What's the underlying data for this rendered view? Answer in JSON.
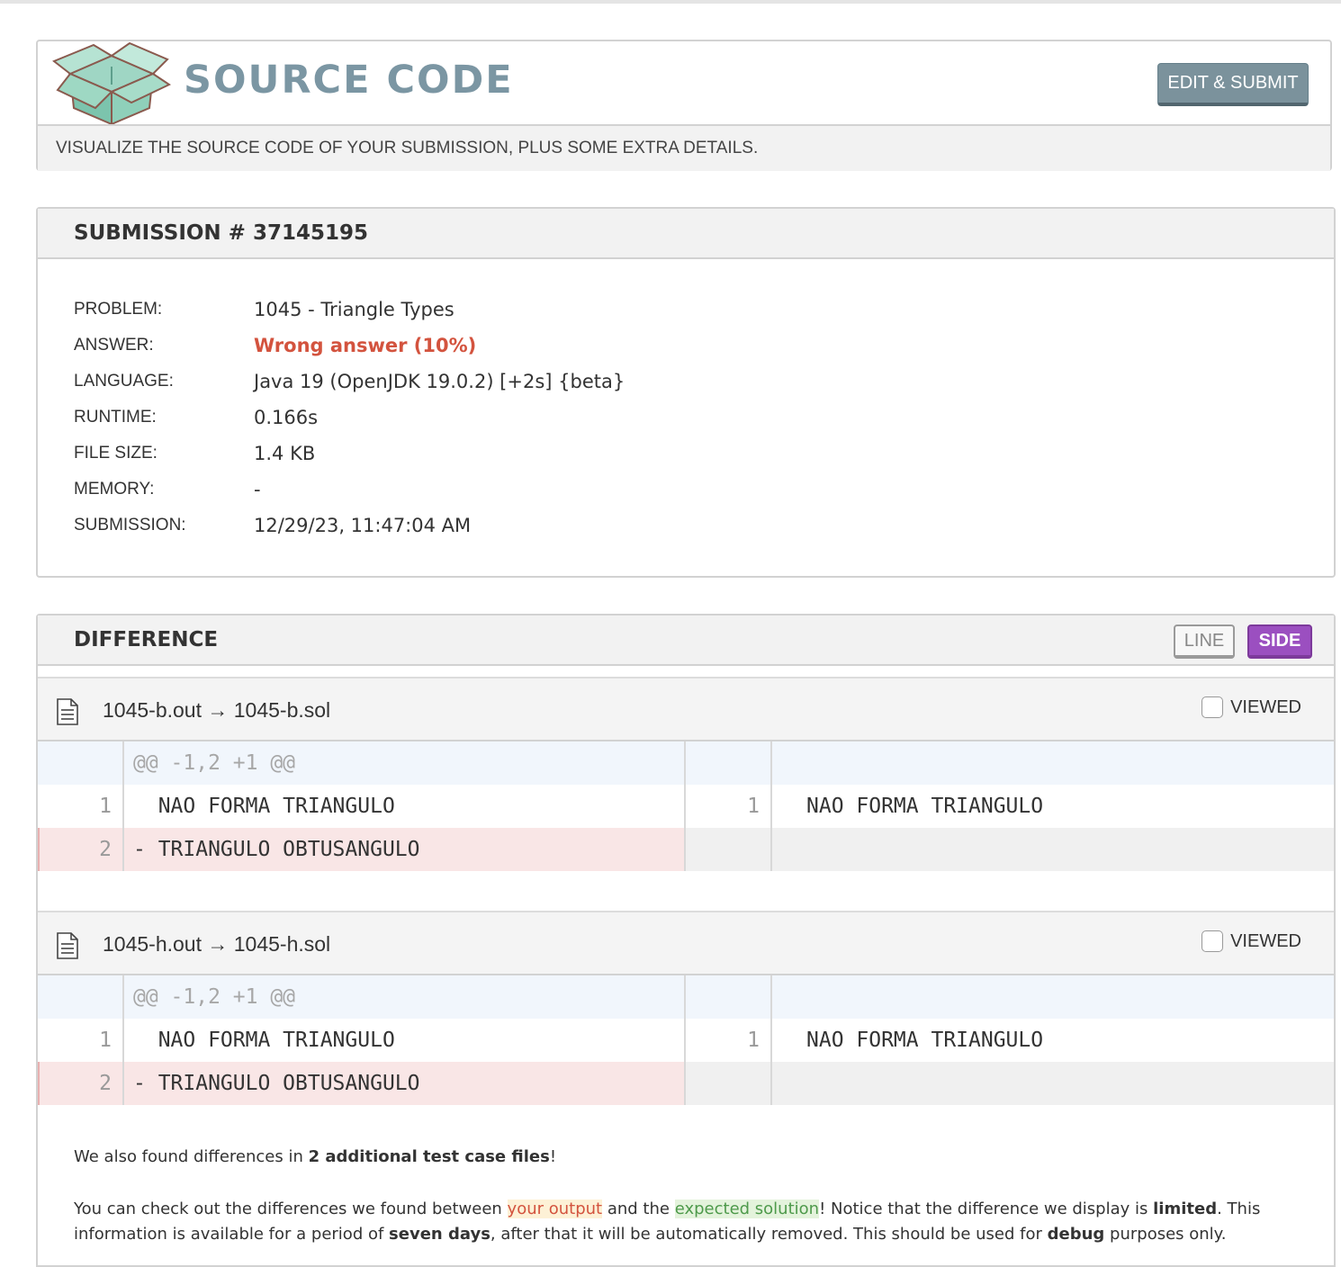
{
  "header": {
    "title": "SOURCE CODE",
    "edit_button": "EDIT & SUBMIT",
    "subtitle": "VISUALIZE THE SOURCE CODE OF YOUR SUBMISSION, PLUS SOME EXTRA DETAILS."
  },
  "submission": {
    "heading": "SUBMISSION # 37145195",
    "rows": [
      {
        "label": "PROBLEM:",
        "value": "1045 - Triangle Types"
      },
      {
        "label": "ANSWER:",
        "value": "Wrong answer (10%)"
      },
      {
        "label": "LANGUAGE:",
        "value": "Java 19 (OpenJDK 19.0.2) [+2s] {beta}"
      },
      {
        "label": "RUNTIME:",
        "value": "0.166s"
      },
      {
        "label": "FILE SIZE:",
        "value": "1.4 KB"
      },
      {
        "label": "MEMORY:",
        "value": "-"
      },
      {
        "label": "SUBMISSION:",
        "value": "12/29/23, 11:47:04 AM"
      }
    ],
    "answer_color": "#d3533e"
  },
  "difference": {
    "heading": "DIFFERENCE",
    "line_button": "LINE",
    "side_button": "SIDE",
    "accent_color": "#9b4fc0",
    "files": [
      {
        "name": "1045-b.out → 1045-b.sol",
        "viewed_label": "VIEWED",
        "hunk": "@@ -1,2 +1 @@",
        "lines": [
          {
            "left_num": "1",
            "left": "  NAO FORMA TRIANGULO",
            "right_num": "1",
            "right": "NAO FORMA TRIANGULO"
          },
          {
            "left_num": "2",
            "left": "- TRIANGULO OBTUSANGULO",
            "right_num": "",
            "right": ""
          }
        ]
      },
      {
        "name": "1045-h.out → 1045-h.sol",
        "viewed_label": "VIEWED",
        "hunk": "@@ -1,2 +1 @@",
        "lines": [
          {
            "left_num": "1",
            "left": "  NAO FORMA TRIANGULO",
            "right_num": "1",
            "right": "NAO FORMA TRIANGULO"
          },
          {
            "left_num": "2",
            "left": "- TRIANGULO OBTUSANGULO",
            "right_num": "",
            "right": ""
          }
        ]
      }
    ],
    "footer": {
      "line1_pre": "We also found differences in ",
      "line1_bold": "2 additional test case files",
      "line1_post": "!",
      "p2_a": "You can check out the differences we found between ",
      "p2_out": "your output",
      "p2_b": " and the ",
      "p2_sol": "expected solution",
      "p2_c": "! Notice that the difference we display is ",
      "p2_limited": "limited",
      "p2_d": ". This information is available for a period of ",
      "p2_seven": "seven days",
      "p2_e": ", after that it will be automatically removed. This should be used for ",
      "p2_debug": "debug",
      "p2_f": " purposes only."
    }
  }
}
